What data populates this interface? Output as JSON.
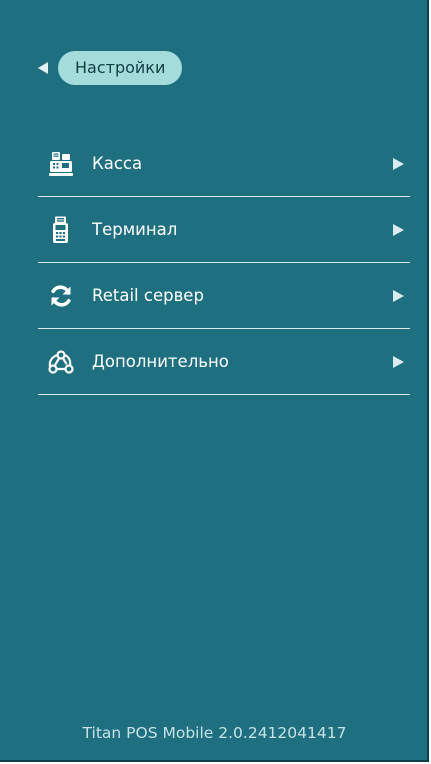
{
  "header": {
    "title": "Настройки",
    "back_icon": "back-arrow-icon"
  },
  "menu": {
    "items": [
      {
        "label": "Касса",
        "icon": "cash-register-icon"
      },
      {
        "label": "Терминал",
        "icon": "payment-terminal-icon"
      },
      {
        "label": "Retail сервер",
        "icon": "sync-icon"
      },
      {
        "label": "Дополнительно",
        "icon": "webhook-icon"
      }
    ]
  },
  "footer": {
    "version": "Titan POS Mobile 2.0.2412041417"
  },
  "colors": {
    "background": "#1e6f7f",
    "pill": "#a4dbdb",
    "text": "#ffffff",
    "divider": "#d7ecee"
  }
}
